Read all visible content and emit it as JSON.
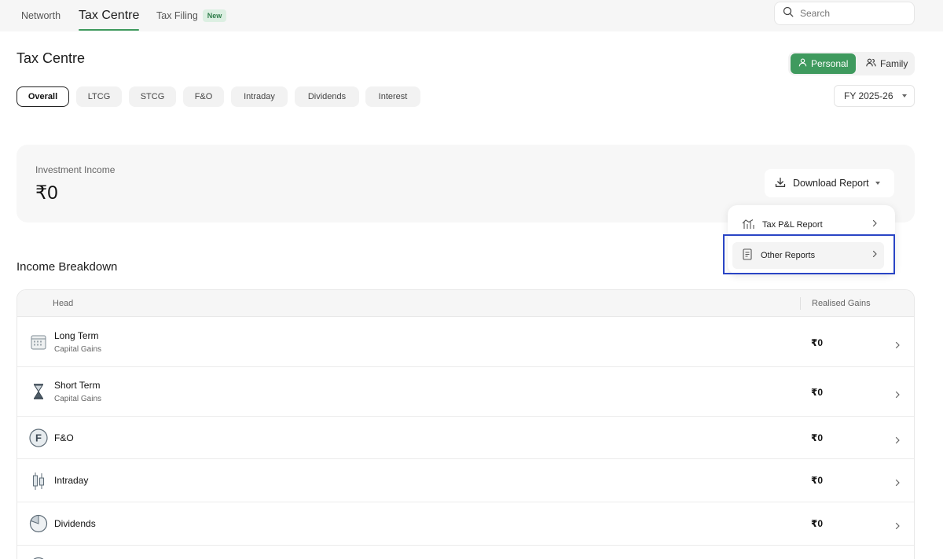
{
  "nav": {
    "tabs": [
      {
        "label": "Networth"
      },
      {
        "label": "Tax Centre"
      },
      {
        "label": "Tax Filing",
        "badge": "New"
      }
    ],
    "search_placeholder": "Search"
  },
  "page_title": "Tax Centre",
  "scope_toggle": {
    "personal": "Personal",
    "family": "Family",
    "selected": "Personal"
  },
  "filters": [
    "Overall",
    "LTCG",
    "STCG",
    "F&O",
    "Intraday",
    "Dividends",
    "Interest"
  ],
  "active_filter": "Overall",
  "fy_select": {
    "value": "FY 2025-26"
  },
  "investment_income": {
    "label": "Investment Income",
    "value": "₹0"
  },
  "download_report": {
    "label": "Download Report",
    "menu": [
      {
        "label": "Tax P&L Report",
        "icon": "tax-chart-icon"
      },
      {
        "label": "Other Reports",
        "icon": "document-icon"
      }
    ]
  },
  "income_breakdown": {
    "title": "Income Breakdown",
    "columns": [
      "Head",
      "Realised Gains"
    ],
    "rows": [
      {
        "name": "Long Term",
        "sub": "Capital Gains",
        "value": "₹0",
        "icon": "calendar-icon"
      },
      {
        "name": "Short Term",
        "sub": "Capital Gains",
        "value": "₹0",
        "icon": "hourglass-icon"
      },
      {
        "name": "F&O",
        "sub": "",
        "value": "₹0",
        "icon": "fo-letter-icon"
      },
      {
        "name": "Intraday",
        "sub": "",
        "value": "₹0",
        "icon": "candlestick-icon"
      },
      {
        "name": "Dividends",
        "sub": "",
        "value": "₹0",
        "icon": "pie-chart-icon"
      }
    ]
  },
  "colors": {
    "accent": "#3f9a5e",
    "highlight": "#2a45c5"
  }
}
